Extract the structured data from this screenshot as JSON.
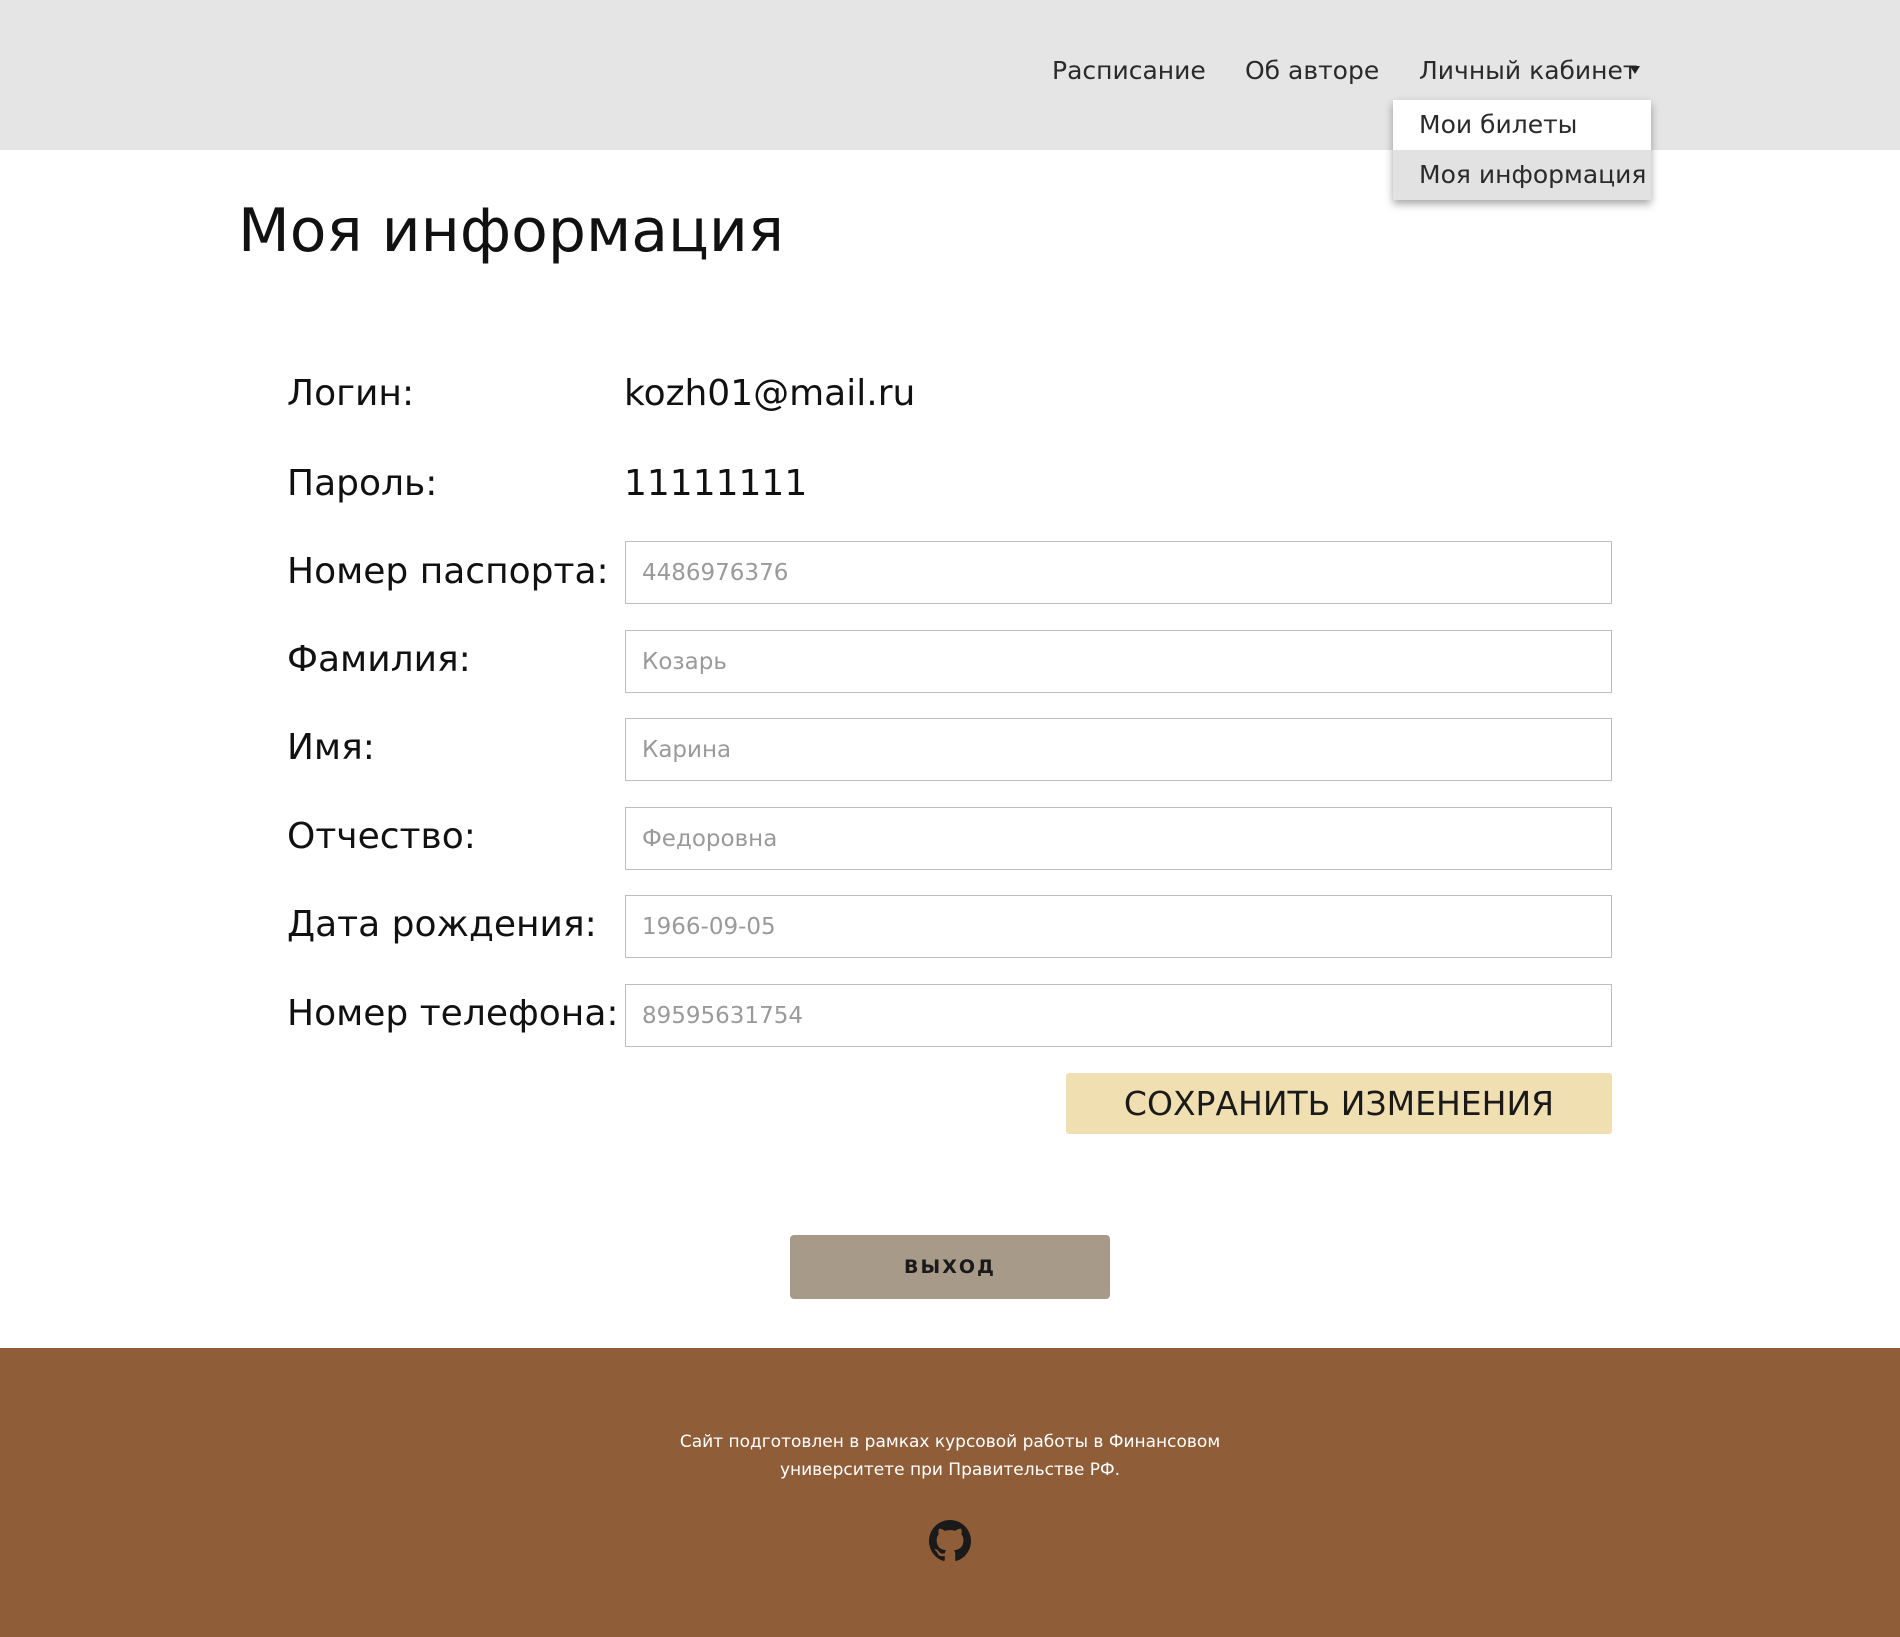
{
  "header": {
    "nav": {
      "schedule": "Расписание",
      "about": "Об авторе",
      "account": "Личный кабинет"
    },
    "dropdown": {
      "tickets": "Мои билеты",
      "info": "Моя информация",
      "active_item": "Моя информация"
    }
  },
  "main": {
    "title": "Моя информация",
    "login_label": "Логин:",
    "login_value": "kozh01@mail.ru",
    "password_label": "Пароль:",
    "password_value": "11111111",
    "fields": {
      "passport": {
        "label": "Номер паспорта:",
        "placeholder": "4486976376"
      },
      "surname": {
        "label": "Фамилия:",
        "placeholder": "Козарь"
      },
      "name": {
        "label": "Имя:",
        "placeholder": "Карина"
      },
      "patronymic": {
        "label": "Отчество:",
        "placeholder": "Федоровна"
      },
      "birthdate": {
        "label": "Дата рождения:",
        "placeholder": "1966-09-05"
      },
      "phone": {
        "label": "Номер телефона:",
        "placeholder": "89595631754"
      }
    },
    "save_label": "СОХРАНИТЬ ИЗМЕНЕНИЯ",
    "logout_label": "ВЫХОД"
  },
  "footer": {
    "line1": "Сайт подготовлен в рамках курсовой работы в Финансовом",
    "line2": "университете при Правительстве РФ.",
    "icon": "github-icon"
  },
  "colors": {
    "header_bg": "#e5e5e5",
    "save_button": "#f0dfb0",
    "logout_button": "#a89a89",
    "footer_bg": "#8f5e38"
  }
}
